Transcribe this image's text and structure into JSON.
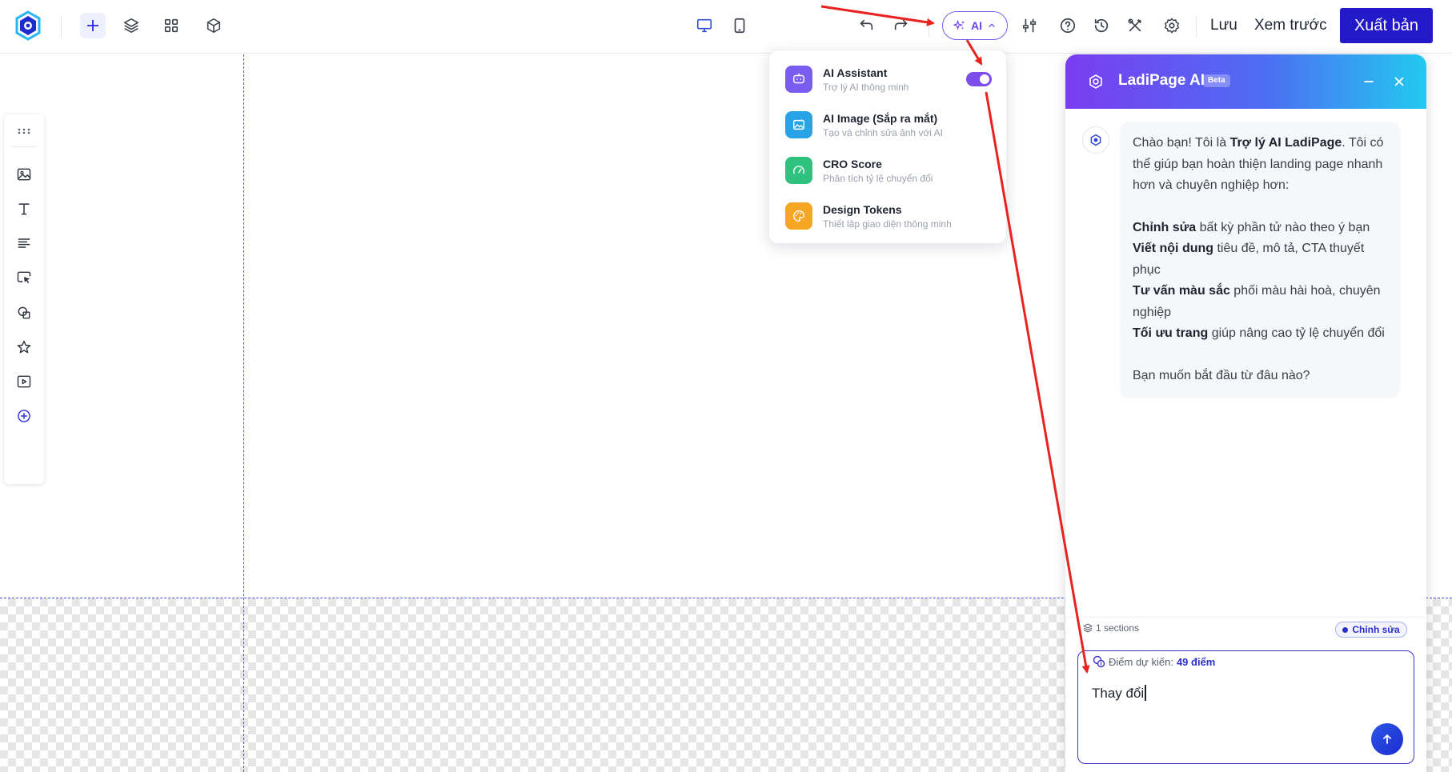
{
  "toolbar": {
    "save_label": "Lưu",
    "preview_label": "Xem trước",
    "publish_label": "Xuất bản",
    "ai_label": "AI"
  },
  "ai_menu": {
    "items": [
      {
        "title": "AI Assistant",
        "subtitle": "Trợ lý AI thông minh",
        "color": "#7b5cf0",
        "icon": "chatbot-icon",
        "toggle_on": true
      },
      {
        "title": "AI Image (Sắp ra mắt)",
        "subtitle": "Tạo và chỉnh sửa ảnh với AI",
        "color": "#27a3e6",
        "icon": "image-sparkle-icon"
      },
      {
        "title": "CRO Score",
        "subtitle": "Phân tích tỷ lệ chuyển đổi",
        "color": "#2ec27e",
        "icon": "gauge-icon"
      },
      {
        "title": "Design Tokens",
        "subtitle": "Thiết lập giao diện thông minh",
        "color": "#f5a623",
        "icon": "palette-icon"
      }
    ]
  },
  "chat": {
    "title": "LadiPage AI",
    "badge": "Beta",
    "message": {
      "intro_1": "Chào bạn! Tôi là ",
      "intro_bold": "Trợ lý AI LadiPage",
      "intro_2": ". Tôi có thể giúp bạn hoàn thiện landing page nhanh hơn và chuyên nghiệp hơn:",
      "features": [
        {
          "bold": "Chỉnh sửa",
          "text": " bất kỳ phần tử nào theo ý bạn"
        },
        {
          "bold": "Viết nội dung",
          "text": " tiêu đề, mô tả, CTA thuyết phục"
        },
        {
          "bold": "Tư vấn màu sắc",
          "text": " phối màu hài hoà, chuyên nghiệp"
        },
        {
          "bold": "Tối ưu trang",
          "text": " giúp nâng cao tỷ lệ chuyển đổi"
        }
      ],
      "closing": "Bạn muốn bắt đầu từ đâu nào?"
    },
    "sections_label": "1 sections",
    "mode_label": "Chỉnh sửa",
    "score_label": "Điểm dự kiến:",
    "score_value": "49 điểm",
    "input_value": "Thay đổi"
  },
  "colors": {
    "brand": "#2419c9",
    "ai_accent": "#7c5cf0",
    "guide": "#4b4bd6",
    "annotation": "#e8231f"
  }
}
